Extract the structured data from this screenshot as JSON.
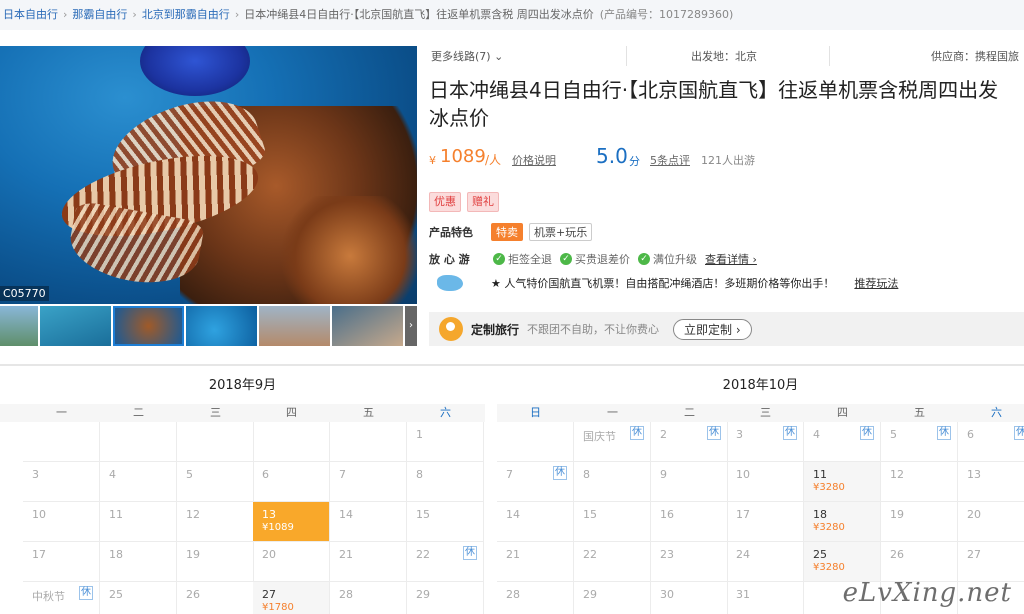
{
  "breadcrumb": {
    "items": [
      "日本自由行",
      "那霸自由行",
      "北京到那霸自由行"
    ],
    "current": "日本冲绳县4日自由行·【北京国航直飞】往返单机票含税 周四出发冰点价",
    "code": "(产品编号：1017289360)"
  },
  "gallery": {
    "photo_code": "C05770",
    "next_arrow": "›"
  },
  "info": {
    "more_lines": "更多线路(7) ⌄",
    "origin": "出发地：北京",
    "supplier": "供应商：携程国旅",
    "title": "日本冲绳县4日自由行·【北京国航直飞】往返单机票含税周四出发冰点价",
    "price_symbol": "¥",
    "price": "1089",
    "price_unit": "/人",
    "price_note": "价格说明",
    "score": "5.0",
    "score_unit": "分",
    "reviews": "5条点评",
    "sold": "121人出游",
    "tags": [
      "优惠",
      "赠礼"
    ],
    "feature_label": "产品特色",
    "features": [
      "特卖",
      "机票+玩乐"
    ],
    "assure_label": "放 心 游",
    "assurances": [
      "拒签全退",
      "买贵退差价",
      "满位升级"
    ],
    "assure_more": "查看详情 ›",
    "promo_text": "★ 人气特价国航直飞机票！自由搭配冲绳酒店！多班期价格等你出手！",
    "promo_link": "推荐玩法"
  },
  "custom": {
    "title": "定制旅行",
    "desc": "不跟团不自助，不让你费心",
    "button": "立即定制 ›"
  },
  "calendar_sep": {
    "title": "2018年9月",
    "weekdays": [
      "一",
      "二",
      "三",
      "四",
      "五",
      "六"
    ],
    "rest_label": "休",
    "cells": {
      "r0c5": "1",
      "r1c0": "3",
      "r1c1": "4",
      "r1c2": "5",
      "r1c3": "6",
      "r1c4": "7",
      "r1c5": "8",
      "r2c0": "10",
      "r2c1": "11",
      "r2c2": "12",
      "r2c3": "13",
      "r2c4": "14",
      "r2c5": "15",
      "r3c0": "17",
      "r3c1": "18",
      "r3c2": "19",
      "r3c3": "20",
      "r3c4": "21",
      "r3c5": "22",
      "r4c0": "中秋节",
      "r4c1": "25",
      "r4c2": "26",
      "r4c3": "27",
      "r4c4": "28",
      "r4c5": "29"
    },
    "prices": {
      "r2c3": "¥1089",
      "r4c3": "¥1780"
    }
  },
  "calendar_oct": {
    "title": "2018年10月",
    "weekdays": [
      "日",
      "一",
      "二",
      "三",
      "四",
      "五",
      "六"
    ],
    "rest_label": "休",
    "cells": {
      "r0c1": "国庆节",
      "r0c2": "2",
      "r0c3": "3",
      "r0c4": "4",
      "r0c5": "5",
      "r0c6": "6",
      "r1c0": "7",
      "r1c1": "8",
      "r1c2": "9",
      "r1c3": "10",
      "r1c4": "11",
      "r1c5": "12",
      "r1c6": "13",
      "r2c0": "14",
      "r2c1": "15",
      "r2c2": "16",
      "r2c3": "17",
      "r2c4": "18",
      "r2c5": "19",
      "r2c6": "20",
      "r3c0": "21",
      "r3c1": "22",
      "r3c2": "23",
      "r3c3": "24",
      "r3c4": "25",
      "r3c5": "26",
      "r3c6": "27",
      "r4c0": "28",
      "r4c1": "29",
      "r4c2": "30",
      "r4c3": "31"
    },
    "prices": {
      "r1c4": "¥3280",
      "r2c4": "¥3280",
      "r3c4": "¥3280"
    }
  },
  "watermark": "eLvXing.net",
  "colors": {
    "accent": "#f5802d",
    "link": "#2a6bb8",
    "selected": "#f9a82a",
    "score": "#1b6fc2"
  }
}
